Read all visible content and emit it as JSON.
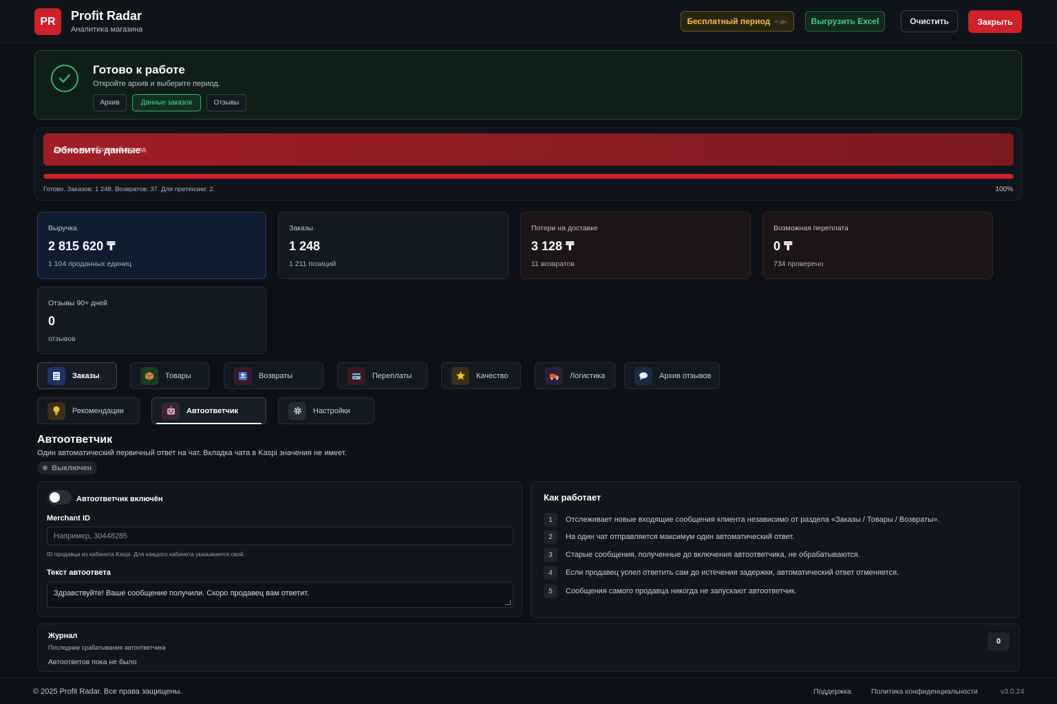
{
  "header": {
    "logo_text": "PR",
    "title": "Profit Radar",
    "subtitle": "Аналитика магазина",
    "trial_label": "Бесплатный период",
    "trial_days": "∞ дн.",
    "excel_label": "Выгрузить Excel",
    "clear_label": "Очистить",
    "close_label": "Закрыть"
  },
  "ready": {
    "title": "Готово к работе",
    "subtitle": "Откройте архив и выберите период.",
    "chips": [
      "Архив",
      "Данные заказов",
      "Отзывы"
    ],
    "active_chip": 1
  },
  "update": {
    "button_label": "Обновить данные",
    "hint": "Данные за выбранный период",
    "status": "Готово. Заказов: 1 248. Возвратов: 37. Для претензии: 2.",
    "percent_label": "100%",
    "progress": 1.0
  },
  "stats": [
    {
      "title": "Выручка",
      "value": "2 815 620 ₸",
      "sub": "1 104 проданных единиц"
    },
    {
      "title": "Заказы",
      "value": "1 248",
      "sub": "1 211 позиций"
    },
    {
      "title": "Потери на доставке",
      "value": "3 128 ₸",
      "sub": "11 возвратов"
    },
    {
      "title": "Возможная переплата",
      "value": "0 ₸",
      "sub": "734 проверено"
    },
    {
      "title": "Отзывы 90+ дней",
      "value": "0",
      "sub": "отзывов"
    }
  ],
  "tabs": [
    {
      "label": "Заказы",
      "icon": "orders-icon"
    },
    {
      "label": "Товары",
      "icon": "box-icon"
    },
    {
      "label": "Возвраты",
      "icon": "return-icon"
    },
    {
      "label": "Переплаты",
      "icon": "card-icon"
    },
    {
      "label": "Качество",
      "icon": "star-icon"
    },
    {
      "label": "Логистика",
      "icon": "truck-icon"
    },
    {
      "label": "Архив отзывов",
      "icon": "chat-icon"
    },
    {
      "label": "Рекомендации",
      "icon": "bulb-icon"
    },
    {
      "label": "Автоответчик",
      "icon": "robot-icon"
    },
    {
      "label": "Настройки",
      "icon": "gear-icon"
    }
  ],
  "section": {
    "title": "Автоответчик",
    "subtitle": "Один автоматический первичный ответ на чат. Вкладка чата в Kaspi значения не имеет.",
    "status": "Выключен"
  },
  "settings": {
    "toggle_label": "Автоответчик включён",
    "merchant_label": "Merchant ID",
    "merchant_placeholder": "Например, 30448285",
    "merchant_hint": "ID продавца из кабинета Kaspi. Для каждого кабинета указывается свой.",
    "reply_label": "Текст автоответа",
    "reply_text": "Здравствуйте! Ваше сообщение получили. Скоро продавец вам ответит."
  },
  "how": {
    "title": "Как работает",
    "steps": [
      {
        "n": "1",
        "text": "Отслеживает новые входящие сообщения клиента независимо от раздела «Заказы / Товары / Возвраты»."
      },
      {
        "n": "2",
        "text": "На один чат отправляется максимум один автоматический ответ."
      },
      {
        "n": "3",
        "text": "Старые сообщения, полученные до включения автоответчика, не обрабатываются."
      },
      {
        "n": "4",
        "text": "Если продавец успел ответить сам до истечения задержки, автоматический ответ отменяется."
      },
      {
        "n": "5",
        "text": "Сообщения самого продавца никогда не запускают автоответчик."
      }
    ]
  },
  "journal": {
    "title": "Журнал",
    "subtitle": "Последние срабатывания автоответчика",
    "empty": "Автоответов пока не было",
    "count": "0"
  },
  "footer": {
    "copyright": "© 2025 Profit Radar. Все права защищены.",
    "support": "Поддержка",
    "privacy": "Политика конфиденциальности",
    "version": "v3.0.24"
  },
  "colors": {
    "accent_red": "#d0202a",
    "success_green": "#2fb86a",
    "trial_yellow": "#f0c040"
  }
}
